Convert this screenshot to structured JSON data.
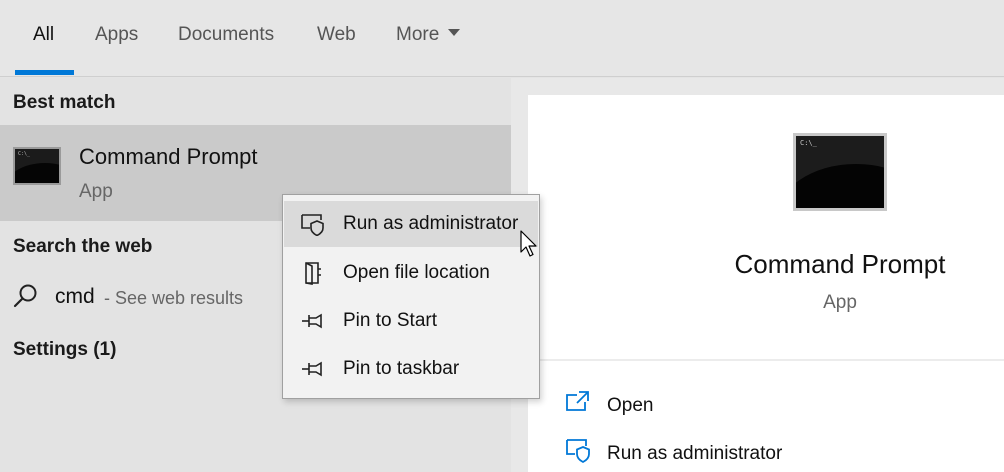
{
  "tabs": [
    {
      "label": "All",
      "active": true
    },
    {
      "label": "Apps",
      "active": false
    },
    {
      "label": "Documents",
      "active": false
    },
    {
      "label": "Web",
      "active": false
    },
    {
      "label": "More",
      "active": false,
      "icon": "chevron-down-icon"
    }
  ],
  "accent_color": "#0078d7",
  "results": {
    "best_match_heading": "Best match",
    "best_match": {
      "title": "Command Prompt",
      "subtitle": "App",
      "icon": "command-prompt-icon",
      "thumb_text": "C:\\_"
    },
    "web_heading": "Search the web",
    "web_result": {
      "query": "cmd",
      "hint": "- See web results",
      "icon": "search-icon"
    },
    "settings_heading": "Settings (1)"
  },
  "detail": {
    "title": "Command Prompt",
    "subtitle": "App",
    "icon": "command-prompt-icon",
    "thumb_text": "C:\\_",
    "actions": [
      {
        "label": "Open",
        "icon": "open-icon"
      },
      {
        "label": "Run as administrator",
        "icon": "shield-icon"
      }
    ]
  },
  "context_menu": {
    "items": [
      {
        "label": "Run as administrator",
        "icon": "shield-icon",
        "hovered": true
      },
      {
        "label": "Open file location",
        "icon": "file-location-icon",
        "hovered": false
      },
      {
        "label": "Pin to Start",
        "icon": "pin-icon",
        "hovered": false
      },
      {
        "label": "Pin to taskbar",
        "icon": "pin-icon",
        "hovered": false
      }
    ]
  }
}
